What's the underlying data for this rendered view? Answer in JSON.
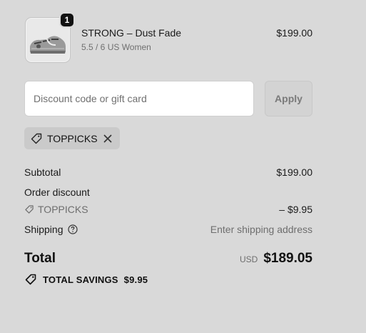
{
  "product": {
    "quantity": "1",
    "name": "STRONG – Dust Fade",
    "variant": "5.5 / 6 US Women",
    "price": "$199.00"
  },
  "discount": {
    "placeholder": "Discount code or gift card",
    "apply_label": "Apply",
    "applied_code": "TOPPICKS"
  },
  "summary": {
    "subtotal_label": "Subtotal",
    "subtotal_value": "$199.00",
    "order_discount_label": "Order discount",
    "discount_code": "TOPPICKS",
    "discount_value": "– $9.95",
    "shipping_label": "Shipping",
    "shipping_value": "Enter shipping address",
    "total_label": "Total",
    "currency": "USD",
    "total_value": "$189.05",
    "savings_label": "TOTAL SAVINGS",
    "savings_value": "$9.95"
  },
  "icons": {
    "tag": "tag-icon",
    "close": "close-icon",
    "help": "help-icon"
  }
}
